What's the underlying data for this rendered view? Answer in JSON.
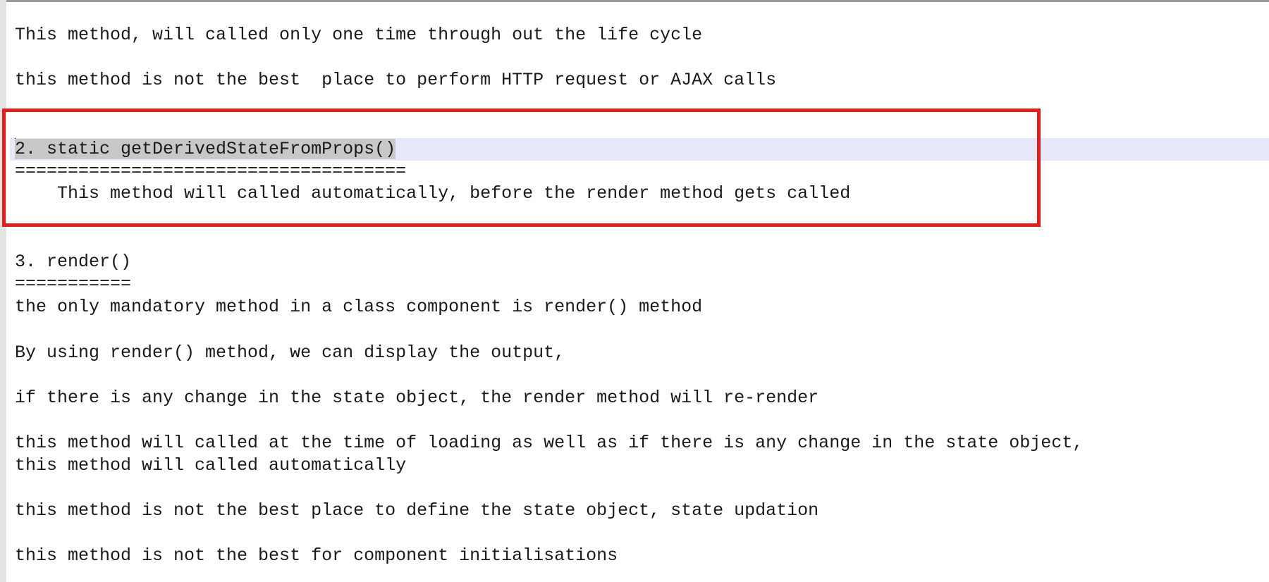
{
  "editor": {
    "lines": [
      "This method, will called only one time through out the life cycle",
      "this method is not the best  place to perform HTTP request or AJAX calls",
      "2. static getDerivedStateFromProps()",
      "=====================================",
      "    This method will called automatically, before the render method gets called",
      "3. render()",
      "===========",
      "the only mandatory method in a class component is render() method",
      "By using render() method, we can display the output,",
      "if there is any change in the state object, the render method will re-render",
      "this method will called at the time of loading as well as if there is any change in the state object,",
      "this method will called automatically",
      "this method is not the best place to define the state object, state updation",
      "this method is not the best for component initialisations"
    ],
    "highlight_color": "#e0201f",
    "current_line_color": "#e8e8fb",
    "selection_color": "#c8c8c8"
  }
}
